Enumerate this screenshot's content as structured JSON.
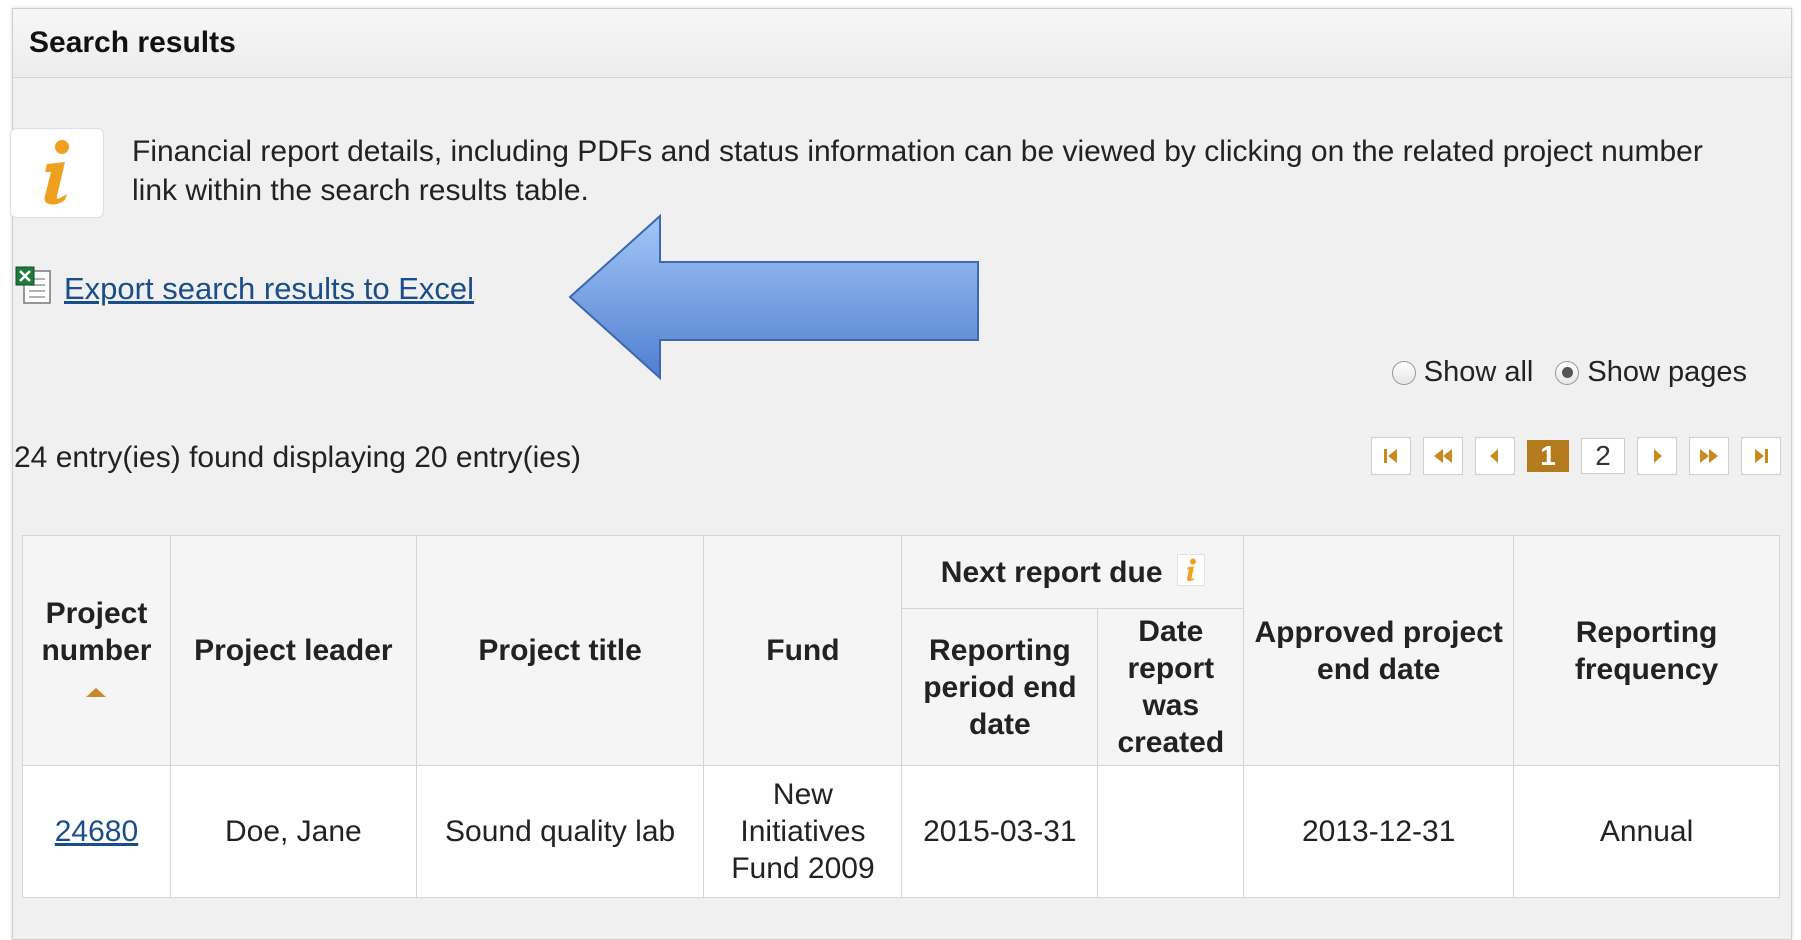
{
  "panel": {
    "title": "Search results"
  },
  "info": {
    "text": "Financial report details, including PDFs and status information can be viewed by clicking on the related project number link within the search results table."
  },
  "export": {
    "label": "Export search results to Excel",
    "icon": "excel-icon"
  },
  "view_toggle": {
    "show_all_label": "Show all",
    "show_pages_label": "Show pages",
    "selected": "Show pages"
  },
  "entries_summary": "24 entry(ies) found displaying 20 entry(ies)",
  "pagination": {
    "current_page": "1",
    "other_page": "2"
  },
  "table": {
    "headers": {
      "project_number": "Project number",
      "project_leader": "Project leader",
      "project_title": "Project title",
      "fund": "Fund",
      "next_report_due": "Next report due",
      "reporting_period_end_date": "Reporting period end date",
      "date_report_created": "Date report was created",
      "approved_end_date": "Approved project end date",
      "reporting_frequency": "Reporting frequency"
    },
    "rows": [
      {
        "project_number": "24680",
        "project_leader": "Doe, Jane",
        "project_title": "Sound quality lab",
        "fund": "New Initiatives Fund 2009",
        "reporting_period_end_date": "2015-03-31",
        "date_report_created": "",
        "approved_end_date": "2013-12-31",
        "reporting_frequency": "Annual"
      }
    ]
  },
  "colors": {
    "link": "#1a4e8a",
    "accent_orange": "#f0a020",
    "current_page_bg": "#b47a1e",
    "arrow_fill": "#6f9fe3"
  }
}
